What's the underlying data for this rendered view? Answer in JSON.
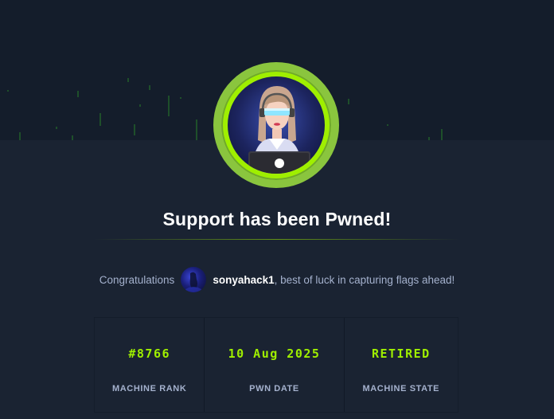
{
  "title": "Support has been Pwned!",
  "congrats": {
    "prefix": "Congratulations",
    "username": "sonyahack1",
    "suffix": ", best of luck in capturing flags ahead!"
  },
  "stats": [
    {
      "value": "#8766",
      "label": "MACHINE RANK"
    },
    {
      "value": "10 Aug 2025",
      "label": "PWN DATE"
    },
    {
      "value": "RETIRED",
      "label": "MACHINE STATE"
    }
  ],
  "colors": {
    "accent": "#9fef00",
    "background": "#1a2332",
    "banner": "#141d2b",
    "muted_text": "#a4b1cd"
  },
  "icons": {
    "machine_avatar": "support-machine-avatar-icon",
    "user_avatar": "user-avatar-icon"
  }
}
